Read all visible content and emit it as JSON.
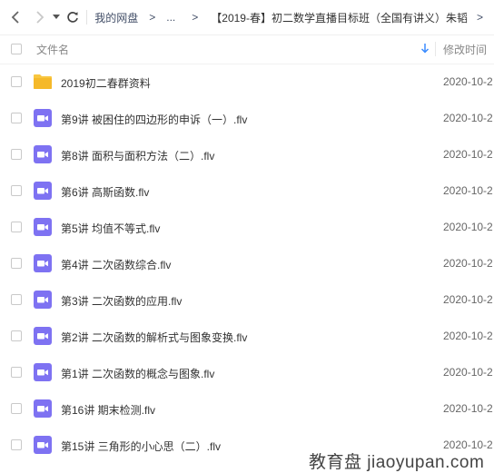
{
  "toolbar": {
    "back_icon": "chevron-left-icon",
    "forward_icon": "chevron-right-icon",
    "history_icon": "caret-down-icon",
    "refresh_icon": "refresh-icon"
  },
  "breadcrumb": {
    "root": "我的网盘",
    "sep": ">",
    "ellipsis": "...",
    "current": "【2019-春】初二数学直播目标班（全国有讲义）朱韬"
  },
  "table": {
    "header_name": "文件名",
    "header_time": "修改时间",
    "sort_icon": "arrow-down-icon",
    "rows": [
      {
        "type": "folder",
        "name": "2019初二春群资料",
        "time": "2020-10-2"
      },
      {
        "type": "video",
        "name": "第9讲 被困住的四边形的申诉（一）.flv",
        "time": "2020-10-2"
      },
      {
        "type": "video",
        "name": "第8讲 面积与面积方法（二）.flv",
        "time": "2020-10-2"
      },
      {
        "type": "video",
        "name": "第6讲 高斯函数.flv",
        "time": "2020-10-2"
      },
      {
        "type": "video",
        "name": "第5讲 均值不等式.flv",
        "time": "2020-10-2"
      },
      {
        "type": "video",
        "name": "第4讲 二次函数综合.flv",
        "time": "2020-10-2"
      },
      {
        "type": "video",
        "name": "第3讲 二次函数的应用.flv",
        "time": "2020-10-2"
      },
      {
        "type": "video",
        "name": "第2讲 二次函数的解析式与图象变换.flv",
        "time": "2020-10-2"
      },
      {
        "type": "video",
        "name": "第1讲 二次函数的概念与图象.flv",
        "time": "2020-10-2"
      },
      {
        "type": "video",
        "name": "第16讲 期末检测.flv",
        "time": "2020-10-2"
      },
      {
        "type": "video",
        "name": "第15讲 三角形的小心思（二）.flv",
        "time": "2020-10-2"
      }
    ]
  },
  "watermark": {
    "text": "教育盘 jiaoyupan.com"
  },
  "colors": {
    "folder": "#f8c640",
    "video": "#7e72f2",
    "link": "#424e67",
    "accent": "#3b8cff"
  }
}
